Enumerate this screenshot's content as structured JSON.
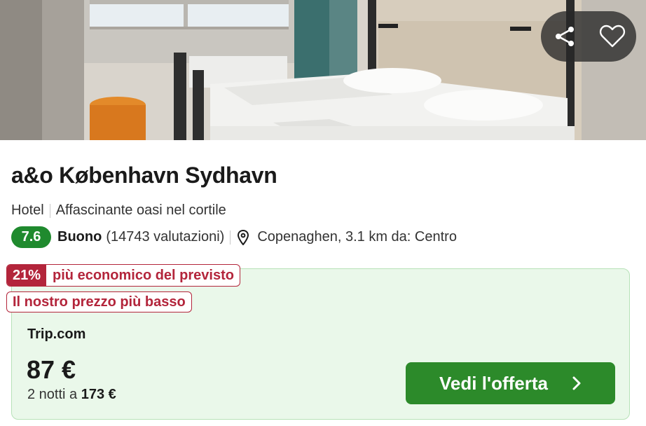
{
  "hotel": {
    "name": "a&o København Sydhavn",
    "type": "Hotel",
    "tagline": "Affascinante oasi nel cortile",
    "score": "7.6",
    "rating_word": "Buono",
    "reviews": "(14743 valutazioni)",
    "location": "Copenaghen, 3.1 km da: Centro"
  },
  "photo": {
    "share_icon": "share-icon",
    "favorite_icon": "heart-icon"
  },
  "offer": {
    "discount_pct": "21%",
    "discount_text": "più economico del previsto",
    "lowest_price_badge": "Il nostro prezzo più basso",
    "provider": "Trip.com",
    "price": "87 €",
    "total_prefix": "2 notti a",
    "total_price": "173 €",
    "cta_label": "Vedi l'offerta"
  },
  "colors": {
    "score_green": "#1f8a2e",
    "cta_green": "#2c8a2a",
    "deal_red": "#b3253b",
    "offer_bg": "#eaf8ea"
  }
}
